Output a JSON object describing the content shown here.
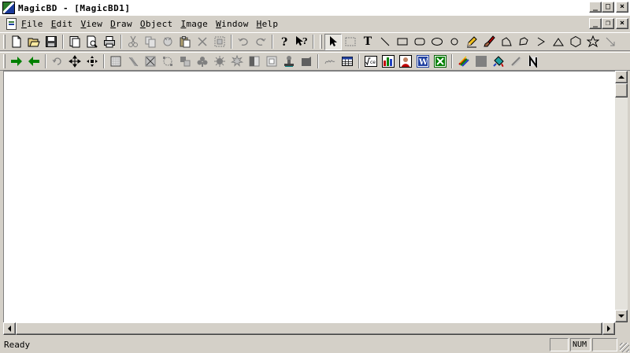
{
  "window": {
    "title": "MagicBD - [MagicBD1]",
    "minimize": "_",
    "maximize": "□",
    "close": "×"
  },
  "mdi": {
    "minimize": "_",
    "restore": "❐",
    "close": "×"
  },
  "menu": {
    "items": [
      {
        "ul": "F",
        "rest": "ile"
      },
      {
        "ul": "E",
        "rest": "dit"
      },
      {
        "ul": "V",
        "rest": "iew"
      },
      {
        "ul": "D",
        "rest": "raw"
      },
      {
        "ul": "O",
        "rest": "bject"
      },
      {
        "ul": "I",
        "rest": "mage"
      },
      {
        "ul": "W",
        "rest": "indow"
      },
      {
        "ul": "H",
        "rest": "elp"
      }
    ]
  },
  "toolbar1": {
    "text_tool_glyph": "T"
  },
  "status": {
    "text": "Ready",
    "num": "NUM"
  },
  "colors": {
    "green_arrow": "#008000",
    "face": "#d4d0c8"
  }
}
